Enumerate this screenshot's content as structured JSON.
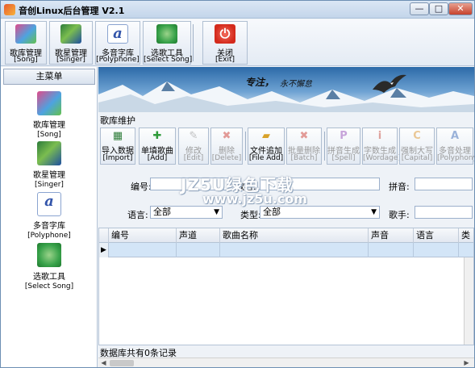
{
  "window": {
    "title": "音创Linux后台管理 V2.1",
    "min": "—",
    "max": "□",
    "close": "✕"
  },
  "toolbar": {
    "items": [
      {
        "label": "歌库管理",
        "sub": "[Song]",
        "icon": "song-library-icon"
      },
      {
        "label": "歌星管理",
        "sub": "[Singer]",
        "icon": "singer-icon"
      },
      {
        "label": "多音字库",
        "sub": "[Polyphone]",
        "icon": "polyphone-icon"
      },
      {
        "label": "选歌工具",
        "sub": "[Select Song]",
        "icon": "select-song-icon"
      },
      {
        "label": "关闭",
        "sub": "[Exit]",
        "icon": "power-icon"
      }
    ],
    "exit_glyph": "⏻"
  },
  "sidebar": {
    "header": "主菜单",
    "items": [
      {
        "label": "歌库管理",
        "sub": "[Song]"
      },
      {
        "label": "歌星管理",
        "sub": "[Singer]"
      },
      {
        "label": "多音字库",
        "sub": "[Polyphone]"
      },
      {
        "label": "选歌工具",
        "sub": "[Select Song]"
      }
    ],
    "poly_glyph": "a"
  },
  "banner": {
    "slogan": "专注，",
    "slogan2": "永不懈怠"
  },
  "section_title": "歌库维护",
  "actions": [
    {
      "label": "导入数据",
      "sub": "[Import]",
      "icon": "import-icon",
      "glyph": "▦",
      "color": "#2f7d3a",
      "enabled": true
    },
    {
      "label": "单填歌曲",
      "sub": "[Add]",
      "icon": "add-icon",
      "glyph": "✚",
      "color": "#2f9b3a",
      "enabled": true
    },
    {
      "label": "修改",
      "sub": "[Edit]",
      "icon": "edit-icon",
      "glyph": "✎",
      "color": "#777777",
      "enabled": false
    },
    {
      "label": "删除",
      "sub": "[Delete]",
      "icon": "delete-icon",
      "glyph": "✖",
      "color": "#c8281e",
      "enabled": false
    },
    {
      "label": "文件追加",
      "sub": "[File Add]",
      "icon": "folder-icon",
      "glyph": "▰",
      "color": "#d8a22a",
      "enabled": true
    },
    {
      "label": "批量删除",
      "sub": "[Batch]",
      "icon": "batch-delete-icon",
      "glyph": "✖",
      "color": "#c8281e",
      "enabled": false
    },
    {
      "label": "拼音生成",
      "sub": "[Spell]",
      "icon": "spell-icon",
      "glyph": "P",
      "color": "#8a3ab0",
      "enabled": false
    },
    {
      "label": "字数生成",
      "sub": "[Wordage]",
      "icon": "wordage-icon",
      "glyph": "i",
      "color": "#c0392b",
      "enabled": false
    },
    {
      "label": "强制大写",
      "sub": "[Capital]",
      "icon": "capital-icon",
      "glyph": "C",
      "color": "#d88a1a",
      "enabled": false
    },
    {
      "label": "多音处理",
      "sub": "[Polyphony]",
      "icon": "polyphony-icon",
      "glyph": "A",
      "color": "#2a5db0",
      "enabled": false
    }
  ],
  "form": {
    "id_label": "编号:",
    "name_label": "歌名:",
    "pinyin_label": "拼音:",
    "lang_label": "语言:",
    "lang_value": "全部",
    "type_label": "类型:",
    "type_value": "全部",
    "singer_label": "歌手:"
  },
  "watermark": {
    "line1": "JZ5U绿色下载",
    "line2": "www.jz5u.com"
  },
  "grid": {
    "columns": [
      "编号",
      "声道",
      "歌曲名称",
      "声音",
      "语言",
      "类"
    ],
    "row_marker": "▶"
  },
  "status": "数据库共有0条记录",
  "scroll": {
    "left": "◀",
    "right": "▶"
  }
}
